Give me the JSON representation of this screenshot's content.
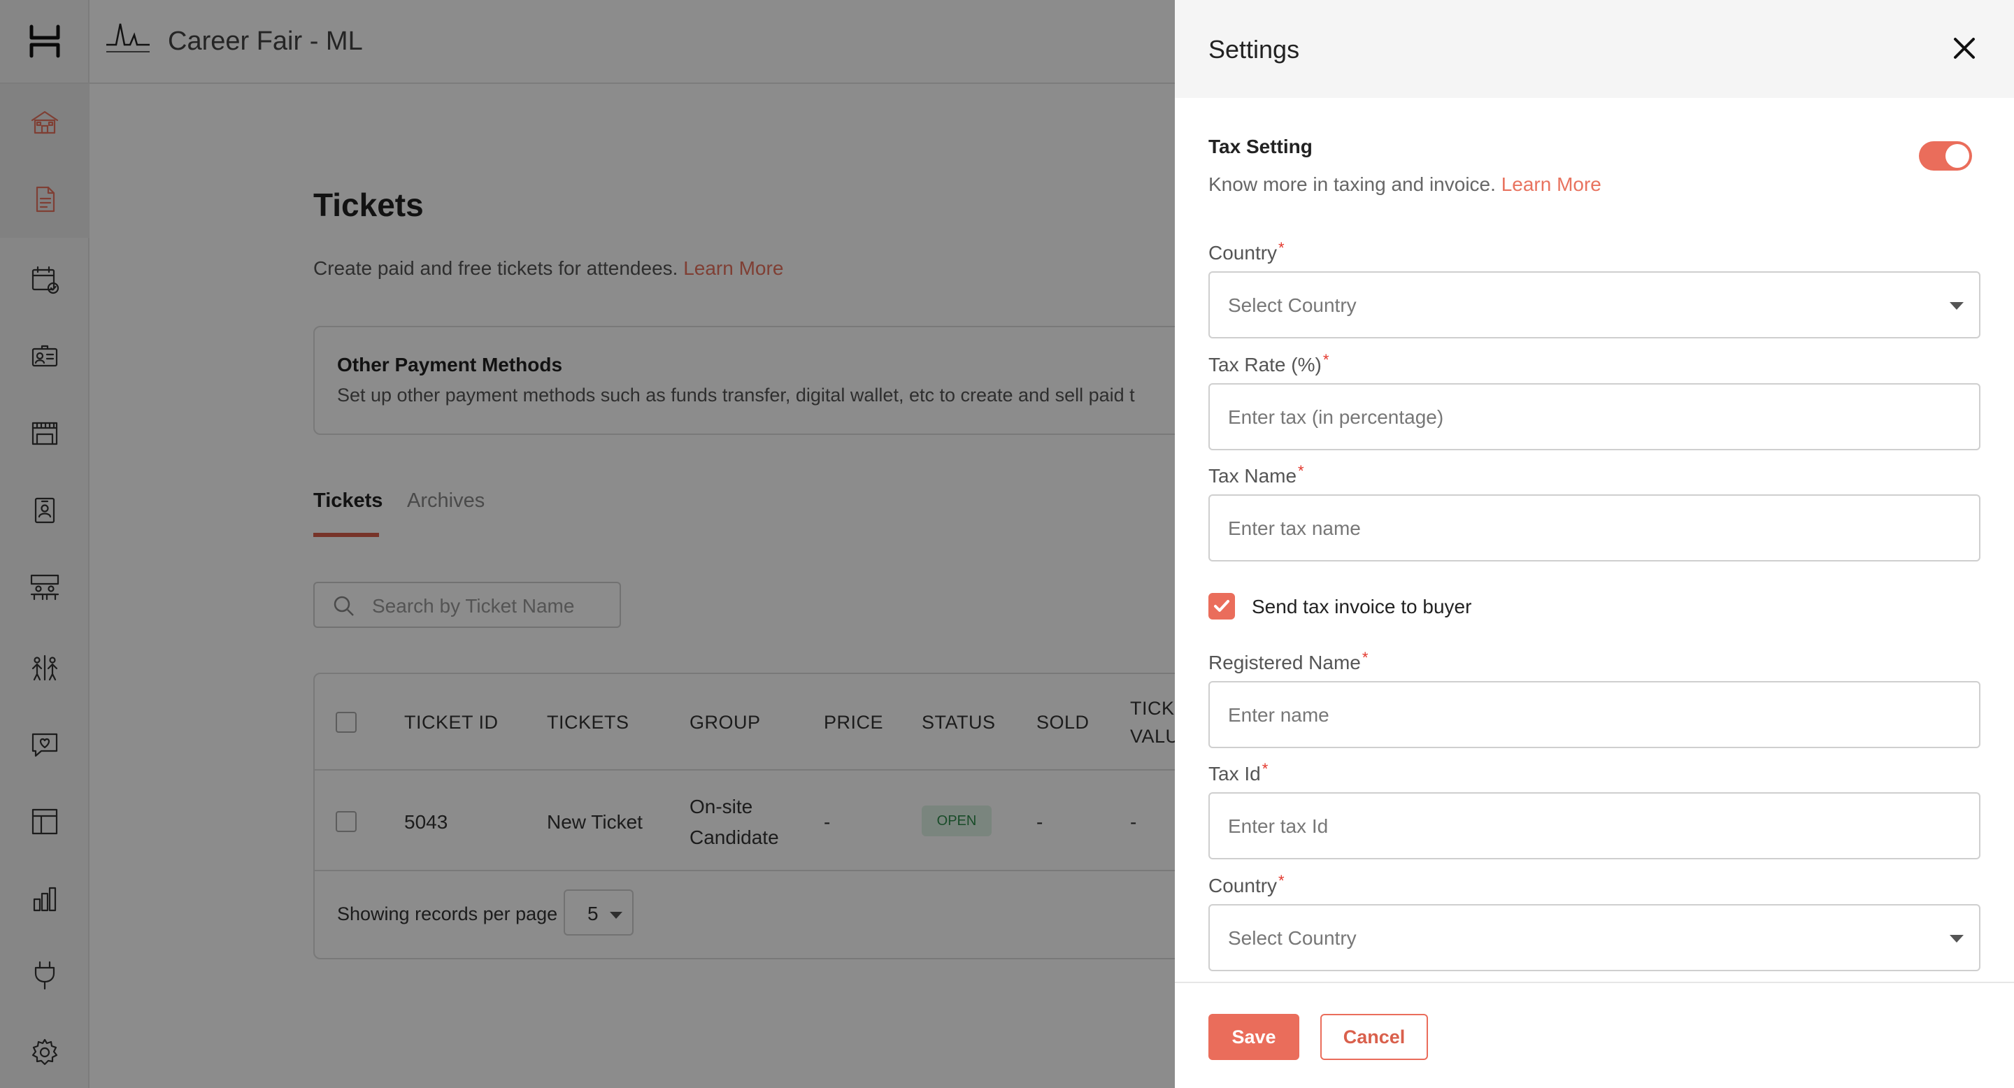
{
  "header": {
    "event_title": "Career Fair - ML"
  },
  "sidebar": {
    "items": [
      {
        "icon": "venue-icon",
        "active": true
      },
      {
        "icon": "document-icon",
        "active": true
      },
      {
        "icon": "schedule-icon",
        "active": false
      },
      {
        "icon": "attendee-card-icon",
        "active": false
      },
      {
        "icon": "booth-icon",
        "active": false
      },
      {
        "icon": "badge-icon",
        "active": false
      },
      {
        "icon": "lounge-icon",
        "active": false
      },
      {
        "icon": "networking-icon",
        "active": false
      },
      {
        "icon": "engagement-icon",
        "active": false
      },
      {
        "icon": "layout-icon",
        "active": false
      },
      {
        "icon": "analytics-icon",
        "active": false
      },
      {
        "icon": "integrations-icon",
        "active": false
      },
      {
        "icon": "settings-icon",
        "active": false
      }
    ]
  },
  "main": {
    "title": "Tickets",
    "subtitle": "Create paid and free tickets for attendees.",
    "learn_more": "Learn More",
    "payment_card": {
      "title": "Other Payment Methods",
      "description": "Set up other payment methods such as funds transfer, digital wallet, etc to create and sell paid t"
    },
    "tabs": [
      {
        "label": "Tickets",
        "active": true
      },
      {
        "label": "Archives",
        "active": false
      }
    ],
    "search": {
      "placeholder": "Search by Ticket Name"
    },
    "table": {
      "columns": [
        "TICKET ID",
        "TICKETS",
        "GROUP",
        "PRICE",
        "STATUS",
        "SOLD",
        "TICK",
        "VALU"
      ],
      "rows": [
        {
          "ticket_id": "5043",
          "ticket": "New Ticket",
          "group_line1": "On-site",
          "group_line2": "Candidate",
          "price": "-",
          "status": "OPEN",
          "sold": "-",
          "value": "-"
        }
      ],
      "per_page_label": "Showing records per page",
      "per_page_value": "5"
    }
  },
  "drawer": {
    "title": "Settings",
    "tax_setting": {
      "title": "Tax Setting",
      "description": "Know more in taxing and invoice.",
      "learn_more": "Learn More",
      "enabled": true
    },
    "fields": {
      "country1": {
        "label": "Country",
        "placeholder": "Select Country"
      },
      "tax_rate": {
        "label": "Tax Rate (%)",
        "placeholder": "Enter tax (in percentage)"
      },
      "tax_name": {
        "label": "Tax Name",
        "placeholder": "Enter tax name"
      },
      "registered_name": {
        "label": "Registered Name",
        "placeholder": "Enter name"
      },
      "tax_id": {
        "label": "Tax Id",
        "placeholder": "Enter tax Id"
      },
      "country2": {
        "label": "Country",
        "placeholder": "Select Country"
      }
    },
    "send_invoice": {
      "label": "Send tax invoice to buyer",
      "checked": true
    },
    "required_mark": "*",
    "save_label": "Save",
    "cancel_label": "Cancel"
  },
  "colors": {
    "accent": "#ea6d5b",
    "overlay": "rgba(0,0,0,0.45)",
    "open_badge_bg": "#dff3e5"
  }
}
